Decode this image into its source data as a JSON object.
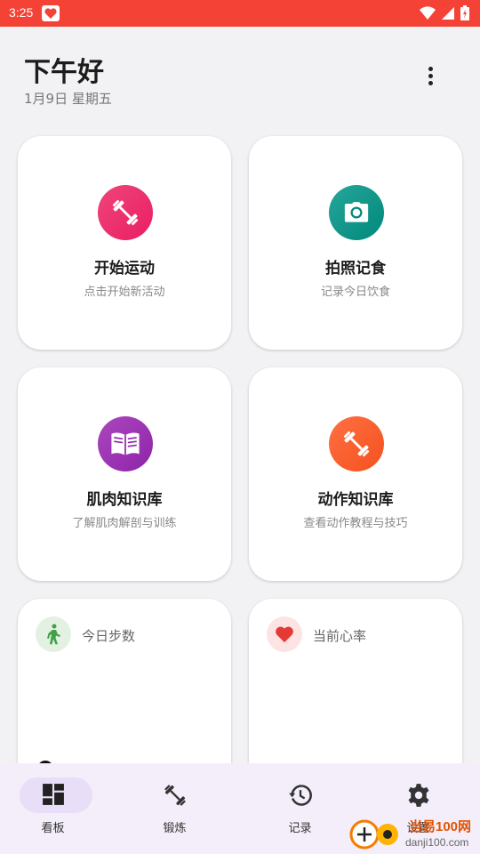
{
  "status_bar": {
    "time": "3:25",
    "icons": [
      "app-notification-icon",
      "wifi-icon",
      "signal-icon",
      "battery-icon"
    ]
  },
  "header": {
    "greeting": "下午好",
    "date": "1月9日 星期五"
  },
  "cards": [
    {
      "title": "开始运动",
      "subtitle": "点击开始新活动",
      "icon": "dumbbell-icon",
      "color": "#e91e63"
    },
    {
      "title": "拍照记食",
      "subtitle": "记录今日饮食",
      "icon": "camera-icon",
      "color": "#00897b"
    },
    {
      "title": "肌肉知识库",
      "subtitle": "了解肌肉解剖与训练",
      "icon": "book-icon",
      "color": "#8e24aa"
    },
    {
      "title": "动作知识库",
      "subtitle": "查看动作教程与技巧",
      "icon": "dumbbell-icon",
      "color": "#f4511e"
    }
  ],
  "stats": [
    {
      "label": "今日步数",
      "icon": "walking-icon",
      "color": "#43a047"
    },
    {
      "label": "当前心率",
      "icon": "heart-icon",
      "color": "#e53935"
    }
  ],
  "bottom_nav": [
    {
      "label": "看板",
      "icon": "dashboard-icon",
      "active": true
    },
    {
      "label": "锻炼",
      "icon": "fitness-icon",
      "active": false
    },
    {
      "label": "记录",
      "icon": "history-icon",
      "active": false
    },
    {
      "label": "设置",
      "icon": "settings-icon",
      "active": false
    }
  ],
  "watermark": {
    "text": "当易100网",
    "domain": "danji100.com"
  }
}
